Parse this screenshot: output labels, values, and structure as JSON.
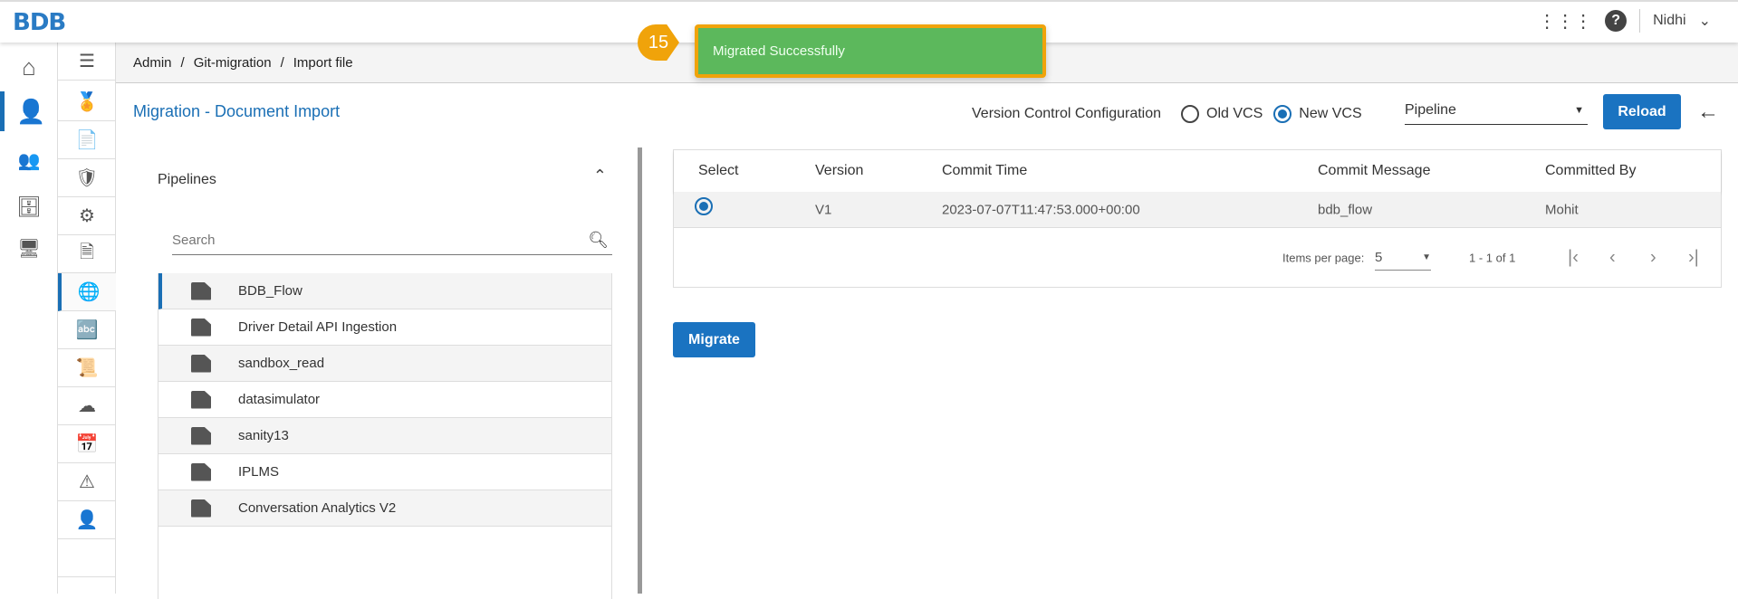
{
  "header": {
    "logo": "BDB",
    "user": "Nidhi"
  },
  "toast": {
    "step": "15",
    "message": "Migrated Successfully"
  },
  "breadcrumb": [
    "Admin",
    "Git-migration",
    "Import file"
  ],
  "page_title": "Migration - Document Import",
  "pipelines": {
    "title": "Pipelines",
    "search_placeholder": "Search",
    "items": [
      "BDB_Flow",
      "Driver Detail API Ingestion",
      "sandbox_read",
      "datasimulator",
      "sanity13",
      "IPLMS",
      "Conversation Analytics V2"
    ]
  },
  "vcs": {
    "label": "Version Control Configuration",
    "old": "Old VCS",
    "new": "New VCS",
    "selected": "new",
    "dropdown": "Pipeline",
    "reload": "Reload"
  },
  "table": {
    "headers": [
      "Select",
      "Version",
      "Commit Time",
      "Commit Message",
      "Committed By"
    ],
    "rows": [
      {
        "version": "V1",
        "time": "2023-07-07T11:47:53.000+00:00",
        "message": "bdb_flow",
        "by": "Mohit"
      }
    ],
    "items_per_page_label": "Items per page:",
    "items_per_page": "5",
    "range": "1 - 1 of 1"
  },
  "migrate": "Migrate",
  "colors": {
    "accent": "#1a73c1",
    "toast": "#5cb85c",
    "highlight": "#f0a30a"
  }
}
